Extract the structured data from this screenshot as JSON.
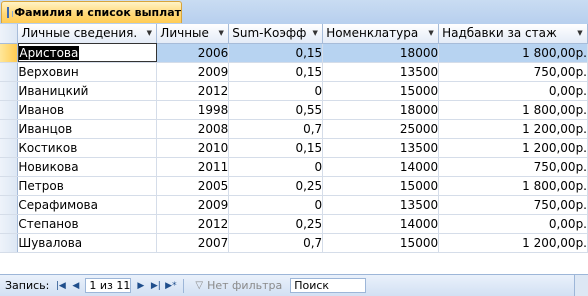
{
  "window": {
    "tab_title": "Фамилия и список выплат"
  },
  "table": {
    "columns": [
      {
        "label": "Личные сведения.",
        "align": "left"
      },
      {
        "label": "Личные",
        "align": "right"
      },
      {
        "label": "Sum-Коэфф",
        "align": "right"
      },
      {
        "label": "Номенклатура",
        "align": "right"
      },
      {
        "label": "Надбавки за стаж",
        "align": "right"
      }
    ],
    "rows": [
      [
        "Аристова",
        "2006",
        "0,15",
        "18000",
        "1 800,00р."
      ],
      [
        "Верховин",
        "2009",
        "0,15",
        "13500",
        "750,00р."
      ],
      [
        "Иваницкий",
        "2012",
        "0",
        "15000",
        "0,00р."
      ],
      [
        "Иванов",
        "1998",
        "0,55",
        "18000",
        "1 800,00р."
      ],
      [
        "Иванцов",
        "2008",
        "0,7",
        "25000",
        "1 200,00р."
      ],
      [
        "Костиков",
        "2010",
        "0,15",
        "13500",
        "1 200,00р."
      ],
      [
        "Новикова",
        "2011",
        "0",
        "14000",
        "750,00р."
      ],
      [
        "Петров",
        "2005",
        "0,25",
        "15000",
        "1 800,00р."
      ],
      [
        "Серафимова",
        "2009",
        "0",
        "13500",
        "750,00р."
      ],
      [
        "Степанов",
        "2012",
        "0,25",
        "14000",
        "0,00р."
      ],
      [
        "Шувалова",
        "2007",
        "0,7",
        "15000",
        "1 200,00р."
      ]
    ],
    "current_row": 0
  },
  "statusbar": {
    "record_label": "Запись:",
    "first_icon": "first-record-icon",
    "prev_icon": "previous-record-icon",
    "record_position": "1 из 11",
    "next_icon": "next-record-icon",
    "last_icon": "last-record-icon",
    "new_icon": "new-record-icon",
    "filter_icon": "funnel-icon",
    "filter_label": "Нет фильтра",
    "search_label": "Поиск"
  }
}
